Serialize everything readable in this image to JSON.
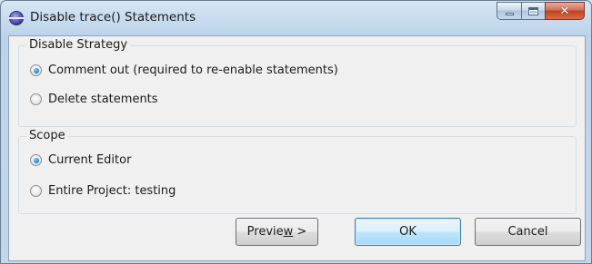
{
  "window": {
    "title": "Disable trace() Statements",
    "icon": "eclipse-app-icon",
    "caption_buttons": [
      "minimize-icon",
      "maximize-icon",
      "close-icon"
    ]
  },
  "strategy_group": {
    "label": "Disable Strategy",
    "options": [
      {
        "label": "Comment out (required to re-enable statements)",
        "checked": true
      },
      {
        "label": "Delete statements",
        "checked": false
      }
    ]
  },
  "scope_group": {
    "label": "Scope",
    "options": [
      {
        "label": "Current Editor",
        "checked": true
      },
      {
        "label": "Entire Project: testing",
        "checked": false
      }
    ]
  },
  "buttons": {
    "preview_pre": "Previe",
    "preview_mnemonic": "w",
    "preview_post": " >",
    "ok": "OK",
    "cancel": "Cancel"
  }
}
